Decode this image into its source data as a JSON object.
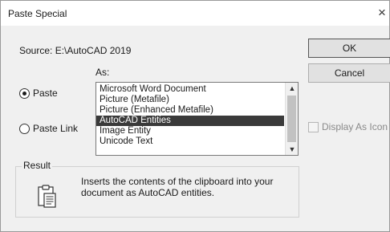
{
  "window": {
    "title": "Paste Special",
    "close_glyph": "×"
  },
  "source": {
    "text": "Source:   E:\\AutoCAD 2019"
  },
  "as_label": "As:",
  "options": {
    "paste_label": "Paste",
    "paste_link_label": "Paste Link",
    "selected": "Paste"
  },
  "formats": {
    "items": [
      "Microsoft Word Document",
      "Picture (Metafile)",
      "Picture (Enhanced Metafile)",
      "AutoCAD Entities",
      "Image Entity",
      "Unicode Text"
    ],
    "selected_index": 3
  },
  "buttons": {
    "ok_label": "OK",
    "cancel_label": "Cancel"
  },
  "display_as_icon": {
    "label": "Display As Icon",
    "checked": false,
    "enabled": false
  },
  "result": {
    "label": "Result",
    "description": "Inserts the contents of the clipboard into your document as AutoCAD entities.",
    "icon": "clipboard-paste-icon"
  },
  "colors": {
    "selection_background": "#3a3a3a",
    "dialog_background": "#f0f0f0"
  }
}
